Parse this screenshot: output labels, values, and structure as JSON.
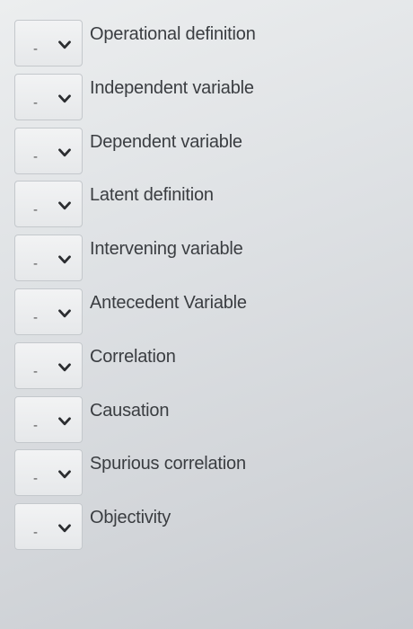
{
  "matching_items": [
    {
      "selected": "-",
      "term": "Operational definition"
    },
    {
      "selected": "-",
      "term": "Independent variable"
    },
    {
      "selected": "-",
      "term": "Dependent variable"
    },
    {
      "selected": "-",
      "term": "Latent definition"
    },
    {
      "selected": "-",
      "term": "Intervening variable"
    },
    {
      "selected": "-",
      "term": "Antecedent Variable"
    },
    {
      "selected": "-",
      "term": "Correlation"
    },
    {
      "selected": "-",
      "term": "Causation"
    },
    {
      "selected": "-",
      "term": "Spurious correlation"
    },
    {
      "selected": "-",
      "term": "Objectivity"
    }
  ],
  "icons": {
    "dropdown": "chevron-down-icon"
  }
}
